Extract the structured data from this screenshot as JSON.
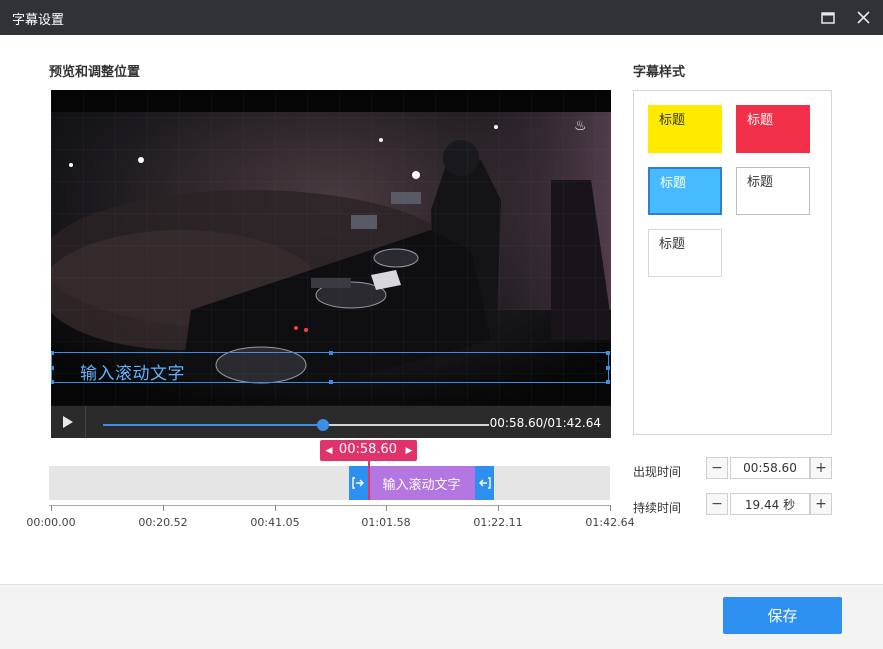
{
  "window": {
    "title": "字幕设置"
  },
  "preview": {
    "section_label": "预览和调整位置",
    "subtitle_text": "输入滚动文字",
    "playback": {
      "current_time": "00:58.60",
      "duration": "01:42.64",
      "time_readout": "00:58.60/01:42.64",
      "progress": 0.571
    }
  },
  "timeline": {
    "cursor_time": "00:58.60",
    "clip_label": "输入滚动文字",
    "ticks": [
      "00:00.00",
      "00:20.52",
      "00:41.05",
      "01:01.58",
      "01:22.11",
      "01:42.64"
    ]
  },
  "styles": {
    "section_label": "字幕样式",
    "items": [
      {
        "label": "标题",
        "bg": "#ffea00",
        "fg": "#333333",
        "border": "#ffea00"
      },
      {
        "label": "标题",
        "bg": "#f3304a",
        "fg": "#ffffff",
        "border": "#f3304a"
      },
      {
        "label": "标题",
        "bg": "#46bbff",
        "fg": "#ffffff",
        "border": "#2d7fd6"
      },
      {
        "label": "标题",
        "bg": "#ffffff",
        "fg": "#333333",
        "border": "#bdbdbd"
      },
      {
        "label": "标题",
        "bg": "#ffffff",
        "fg": "#333333",
        "border": "#d8d8d8"
      }
    ]
  },
  "timing": {
    "appear_label": "出现时间",
    "appear_value": "00:58.60",
    "duration_label": "持续时间",
    "duration_value": "19.44 秒"
  },
  "footer": {
    "save_label": "保存"
  },
  "icons": {
    "maximize": "maximize-icon",
    "close": "close-icon",
    "play": "play-icon"
  },
  "colors": {
    "accent": "#2d8ff0",
    "cursor": "#e0336b",
    "clip": "#b476e0"
  }
}
